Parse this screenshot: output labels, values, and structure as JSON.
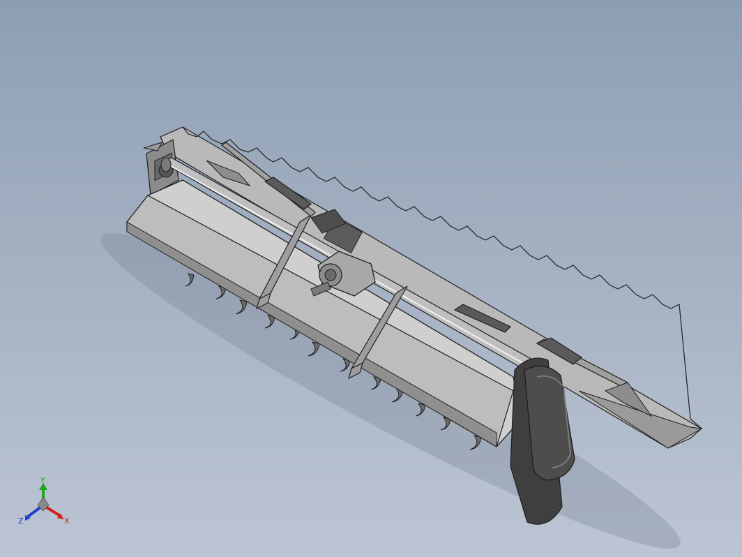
{
  "scene": {
    "colors": {
      "background_top": "#8e9eb2",
      "background_bottom": "#bcc5d3",
      "part_light": "#c9c9c9",
      "part_mid": "#a7a7a7",
      "part_dark": "#5e5e5e",
      "edge": "#1e1e1e",
      "shadow": "#6f7a8a"
    }
  },
  "triad": {
    "x_label": "X",
    "y_label": "Y",
    "z_label": "Z",
    "x_color": "#d21e1e",
    "y_color": "#1ea51e",
    "z_color": "#1e3cd2"
  }
}
